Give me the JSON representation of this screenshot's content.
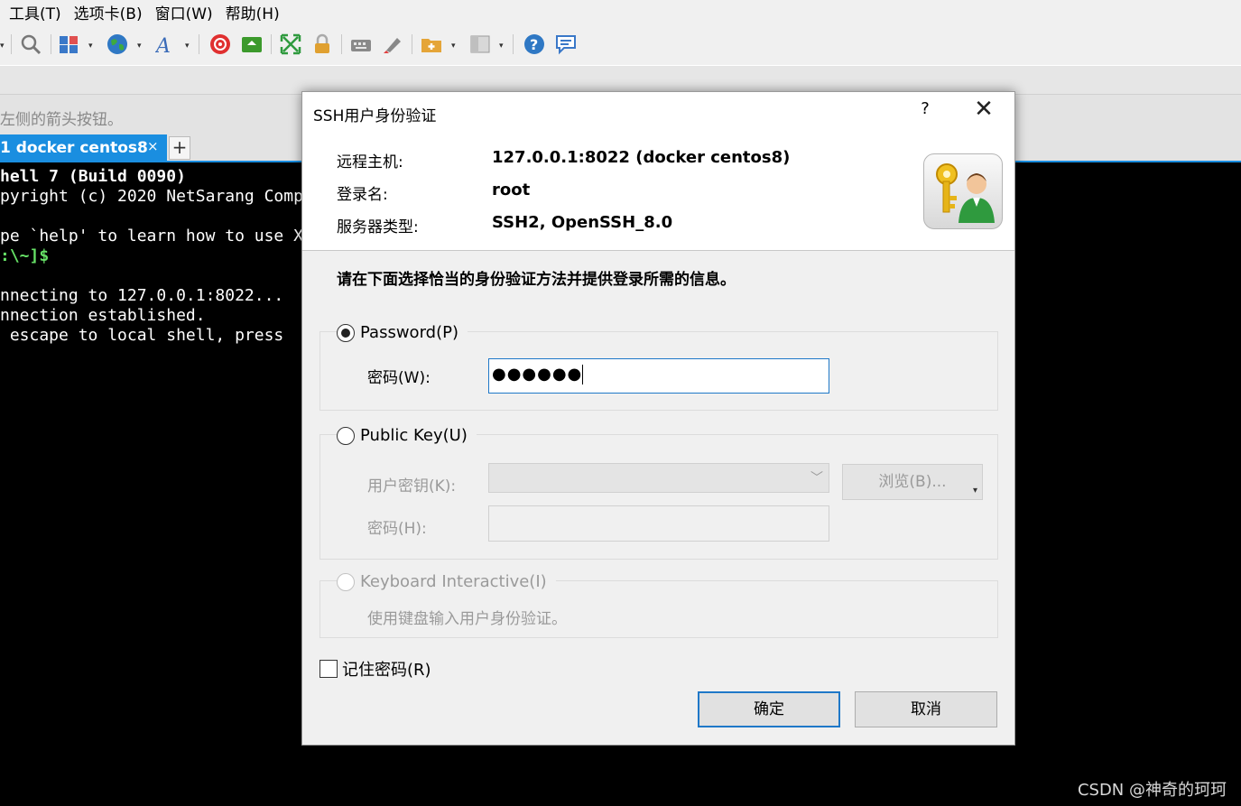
{
  "menu": [
    "工具(T)",
    "选项卡(B)",
    "窗口(W)",
    "帮助(H)"
  ],
  "toolbar_icons": [
    "search-icon",
    "layout-icon",
    "globe-icon",
    "font-icon",
    "spiral-icon",
    "transfer-icon",
    "fullscreen-icon",
    "lock-icon",
    "keyboard-icon",
    "highlight-icon",
    "folder-add-icon",
    "panel-icon",
    "help-icon",
    "chat-icon"
  ],
  "hint_text": "左侧的箭头按钮。",
  "tab": {
    "label": "1 docker centos8",
    "close": "×",
    "add": "+"
  },
  "terminal": {
    "lines": [
      "hell 7 (Build 0090)",
      "pyright (c) 2020 NetSarang Comp",
      "",
      "pe `help' to learn how to use X",
      ":\\~]$",
      "",
      "nnecting to 127.0.0.1:8022...",
      "nnection established.",
      " escape to local shell, press "
    ]
  },
  "watermark": "CSDN @神奇的珂珂",
  "dialog": {
    "title": "SSH用户身份验证",
    "help": "?",
    "close": "✕",
    "remote_host_label": "远程主机:",
    "remote_host_value": "127.0.0.1:8022 (docker centos8)",
    "login_label": "登录名:",
    "login_value": "root",
    "server_type_label": "服务器类型:",
    "server_type_value": "SSH2, OpenSSH_8.0",
    "instruction": "请在下面选择恰当的身份验证方法并提供登录所需的信息。",
    "password_option": "Password(P)",
    "password_label": "密码(W):",
    "password_value": "●●●●●●",
    "public_key_option": "Public Key(U)",
    "user_key_label": "用户密钥(K):",
    "browse_label": "浏览(B)...",
    "passphrase_label": "密码(H):",
    "keyboard_option": "Keyboard Interactive(I)",
    "keyboard_desc": "使用键盘输入用户身份验证。",
    "remember_label": "记住密码(R)",
    "ok_label": "确定",
    "cancel_label": "取消"
  },
  "colors": {
    "accent": "#1a8ee0",
    "focus_border": "#1f78c8",
    "prompt": "#66e066"
  }
}
